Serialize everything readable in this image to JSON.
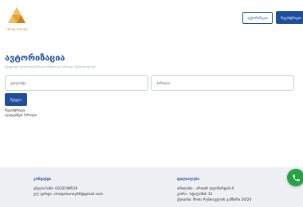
{
  "header": {
    "logo_text": "cheap money",
    "register_label": "ავტორიზაცია",
    "login_label": "რეგისტრაცია"
  },
  "auth": {
    "title": "ავტორიზაცია",
    "subtitle": "შეიყვანეთ ელფოსტა/პირადი ნომერი და პაროლი შესასვლელად",
    "id_placeholder": "ელფოსტა",
    "password_placeholder": "პაროლი",
    "submit_label": "შესვლა",
    "register_link": "რეგისტრაცია",
    "forgot_link": "აღადგინეთ პაროლი"
  },
  "footer": {
    "contact_heading": "კონტაქტი",
    "phone_line": "ცხელი ხაზი: 0322198519",
    "email_line": "ელ ფოსტა: cheapmoney60@gmail.com",
    "branches_heading": "ფილიალები",
    "branches": [
      "თბილისი - ართურ ლეონარდის 4",
      "გორი - სტალინის 12",
      "ქუთაისი: შოთა რუსთაველის გამზირი 20/24"
    ]
  },
  "colors": {
    "brand_blue": "#1d4f9e",
    "logo_orange": "#e8a030",
    "call_green": "#25a244"
  },
  "icons": {
    "logo": "triangle-logo-icon",
    "call": "phone-icon"
  }
}
